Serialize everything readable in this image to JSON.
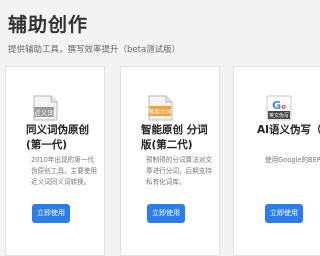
{
  "page": {
    "title": "辅助创作",
    "subtitle": "提供辅助工具，撰写效率提升（beta测试版）"
  },
  "colors": {
    "accent": "#2b7de9",
    "background": "#f3f3f3",
    "card": "#ffffff",
    "smart_tag": "#f0a13a"
  },
  "cards": [
    {
      "icon": "synonym-doc-icon",
      "icon_label": "近义词",
      "title": "同义词伪原创(第一代)",
      "description": "2010年出现的第一代伪原创工具，主要使用近义词同义词转换。",
      "button": "立即使用"
    },
    {
      "icon": "smart-segment-doc-icon",
      "icon_label": "智能分词",
      "title": "智能原创 分词版(第二代)",
      "description": "预制得的分词算法对文章进行分词，后期支持私有化词库。",
      "button": "立即使用"
    },
    {
      "icon": "google-translate-icon",
      "icon_label": "英文伪写",
      "title": "AI语义伪写（第",
      "description": "使用Google的BERT技术,超强技术实力,全自动化翻译生产。",
      "button": "立即使用"
    }
  ]
}
